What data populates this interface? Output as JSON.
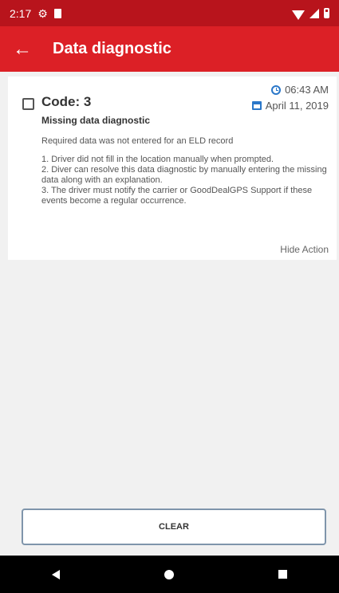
{
  "status_bar": {
    "time": "2:17",
    "icons": [
      "gear-icon",
      "sdcard-icon",
      "wifi-icon",
      "signal-icon",
      "battery-icon"
    ]
  },
  "app_bar": {
    "title": "Data diagnostic",
    "back_icon": "arrow-left-icon"
  },
  "card": {
    "code": "Code: 3",
    "time": "06:43 AM",
    "date": "April 11, 2019",
    "subtitle": "Missing data diagnostic",
    "description": "Required data was not entered for an ELD record",
    "steps": "1. Driver did not fill in the location manually when prompted.\n2. Diver can resolve this data diagnostic by manually entering the missing data along with an explanation.\n3. The driver must notify the carrier or GoodDealGPS Support if these events become a regular occurrence.",
    "hide_action": "Hide Action"
  },
  "actions": {
    "clear_label": "CLEAR"
  },
  "colors": {
    "status_bar": "#b8141c",
    "app_bar": "#dc2026",
    "accent_blue": "#2a77c9"
  }
}
